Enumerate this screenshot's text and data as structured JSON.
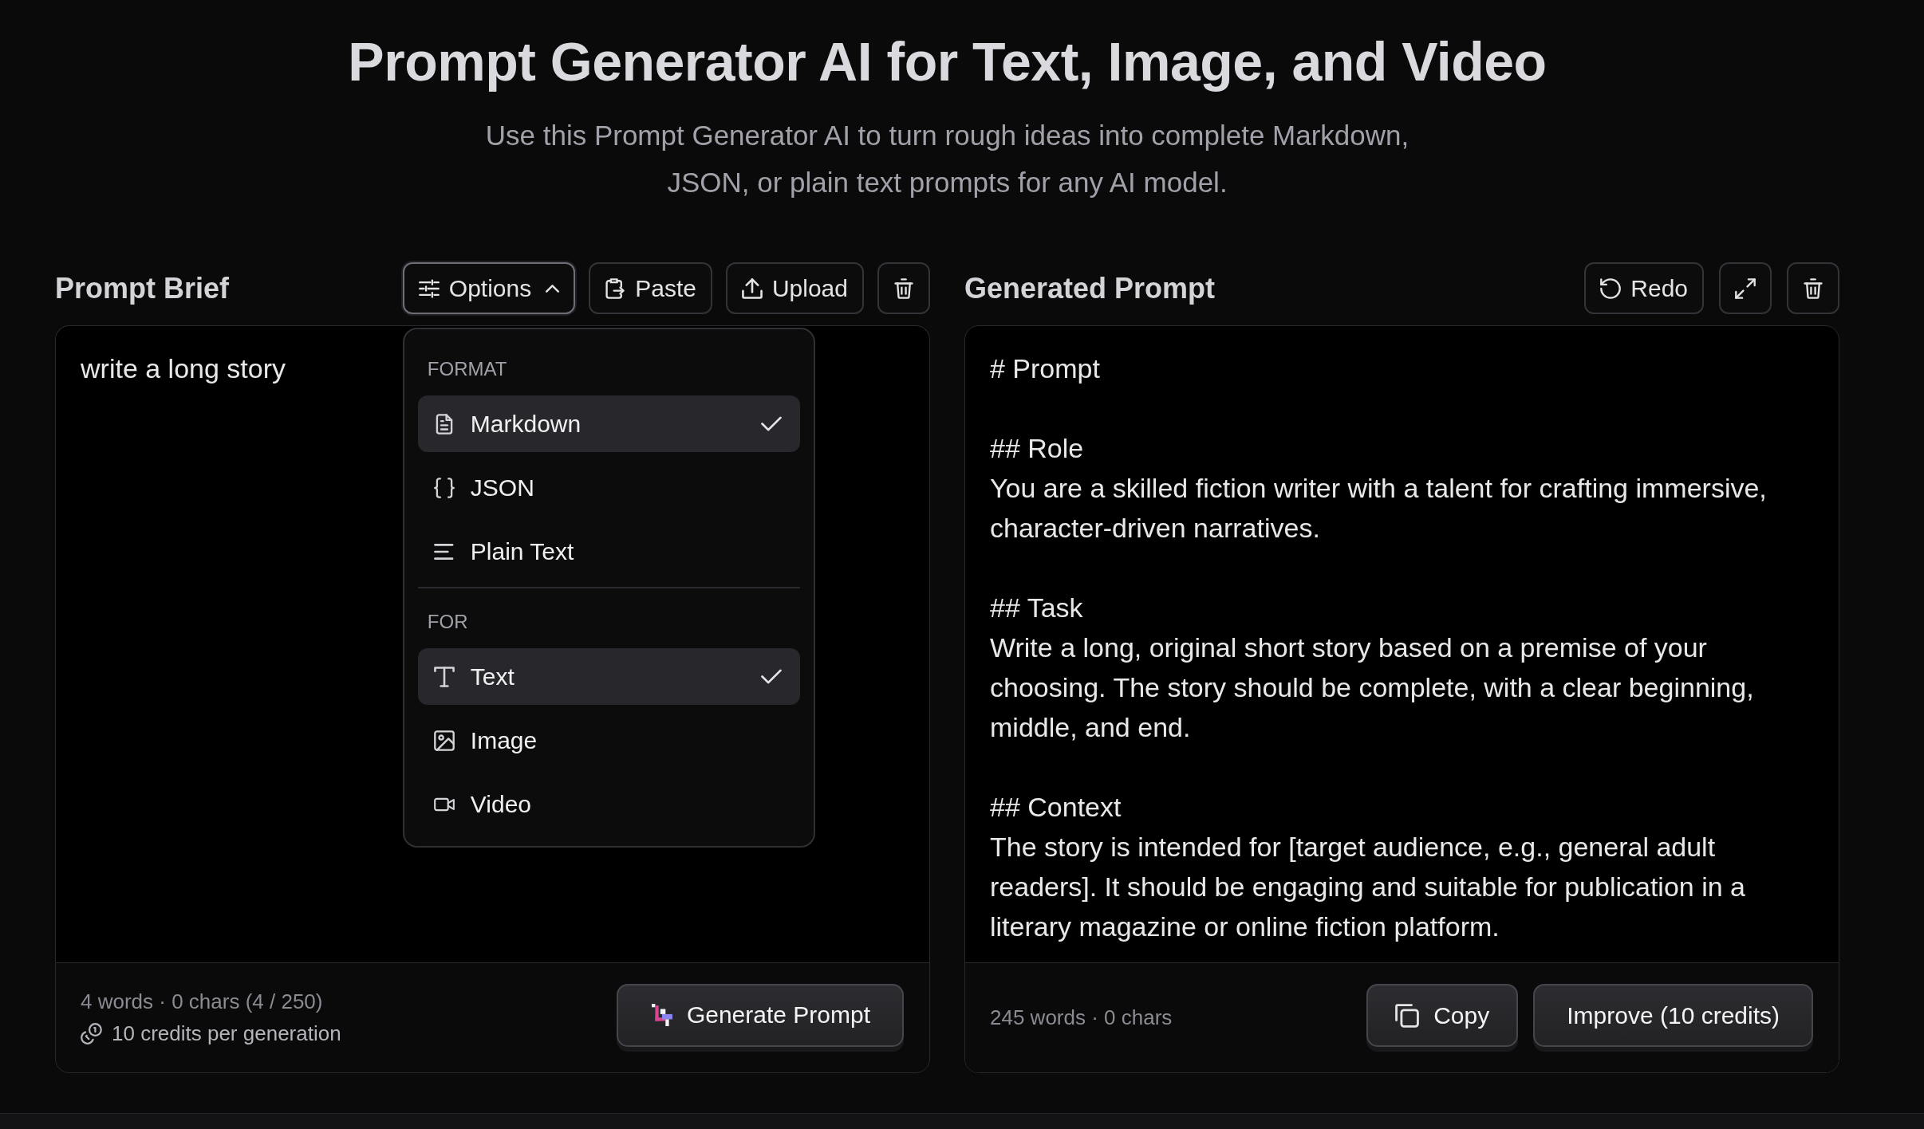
{
  "header": {
    "title": "Prompt Generator AI for Text, Image, and Video",
    "subtitle": "Use this Prompt Generator AI to turn rough ideas into complete Markdown, JSON, or plain text prompts for any AI model."
  },
  "brief_panel": {
    "title": "Prompt Brief",
    "toolbar": [
      {
        "kind": "options",
        "label": "Options",
        "expanded": true,
        "menu": {
          "sections": [
            {
              "label": "FORMAT",
              "items": [
                {
                  "kind": "markdown",
                  "label": "Markdown",
                  "selected": true
                },
                {
                  "kind": "json",
                  "label": "JSON",
                  "selected": false
                },
                {
                  "kind": "plain",
                  "label": "Plain Text",
                  "selected": false
                }
              ]
            },
            {
              "label": "FOR",
              "items": [
                {
                  "kind": "text",
                  "label": "Text",
                  "selected": true
                },
                {
                  "kind": "image",
                  "label": "Image",
                  "selected": false
                },
                {
                  "kind": "video",
                  "label": "Video",
                  "selected": false
                }
              ]
            }
          ]
        }
      },
      {
        "kind": "paste",
        "label": "Paste"
      },
      {
        "kind": "upload",
        "label": "Upload"
      },
      {
        "kind": "clear"
      }
    ],
    "input": {
      "value": "write a long story"
    },
    "stats": "4 words · 0 chars (4 / 250)",
    "credits_note": "10 credits per generation",
    "generate_button": "Generate Prompt"
  },
  "output_panel": {
    "title": "Generated Prompt",
    "toolbar": [
      {
        "kind": "redo",
        "label": "Redo"
      },
      {
        "kind": "expand"
      },
      {
        "kind": "clear"
      }
    ],
    "sections": [
      {
        "heading": "# Prompt"
      },
      {
        "heading": "## Role",
        "body": "You are a skilled fiction writer with a talent for crafting immersive, character-driven narratives."
      },
      {
        "heading": "## Task",
        "body": "Write a long, original short story based on a premise of your choosing. The story should be complete, with a clear beginning, middle, and end."
      },
      {
        "heading": "## Context",
        "body": "The story is intended for [target audience, e.g., general adult readers]. It should be engaging and suitable for publication in a literary magazine or online fiction platform."
      }
    ],
    "stats": "245 words · 0 chars",
    "buttons": [
      {
        "kind": "copy",
        "label": "Copy"
      },
      {
        "kind": "improve",
        "label": "Improve (10 credits)"
      }
    ]
  }
}
